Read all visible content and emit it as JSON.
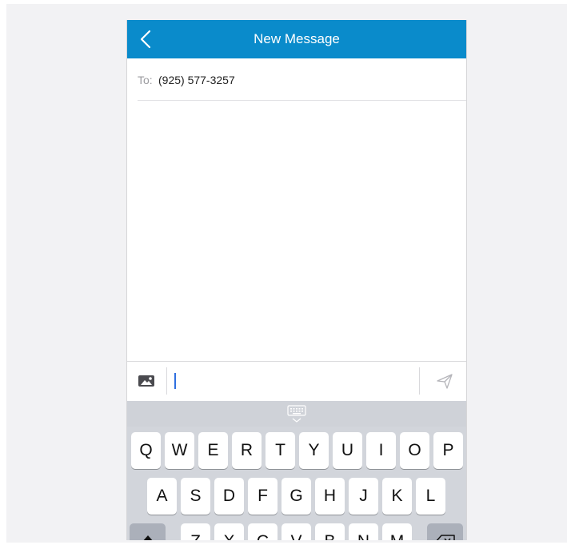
{
  "header": {
    "title": "New Message",
    "back_icon": "chevron-left-icon"
  },
  "recipient": {
    "label": "To:",
    "value": "(925) 577-3257"
  },
  "composer": {
    "message_value": "",
    "photo_icon": "image-icon",
    "send_icon": "paper-plane-icon"
  },
  "keyboard": {
    "hide_icon": "keyboard-hide-icon",
    "row1": [
      "Q",
      "W",
      "E",
      "R",
      "T",
      "Y",
      "U",
      "I",
      "O",
      "P"
    ],
    "row2": [
      "A",
      "S",
      "D",
      "F",
      "G",
      "H",
      "J",
      "K",
      "L"
    ],
    "row3": [
      "Z",
      "X",
      "C",
      "V",
      "B",
      "N",
      "M"
    ],
    "shift_icon": "shift-icon",
    "delete_icon": "backspace-icon"
  },
  "colors": {
    "header_bg": "#0a8bcb",
    "caret": "#2f6fe0",
    "keyboard_bg": "#d2d5db"
  }
}
